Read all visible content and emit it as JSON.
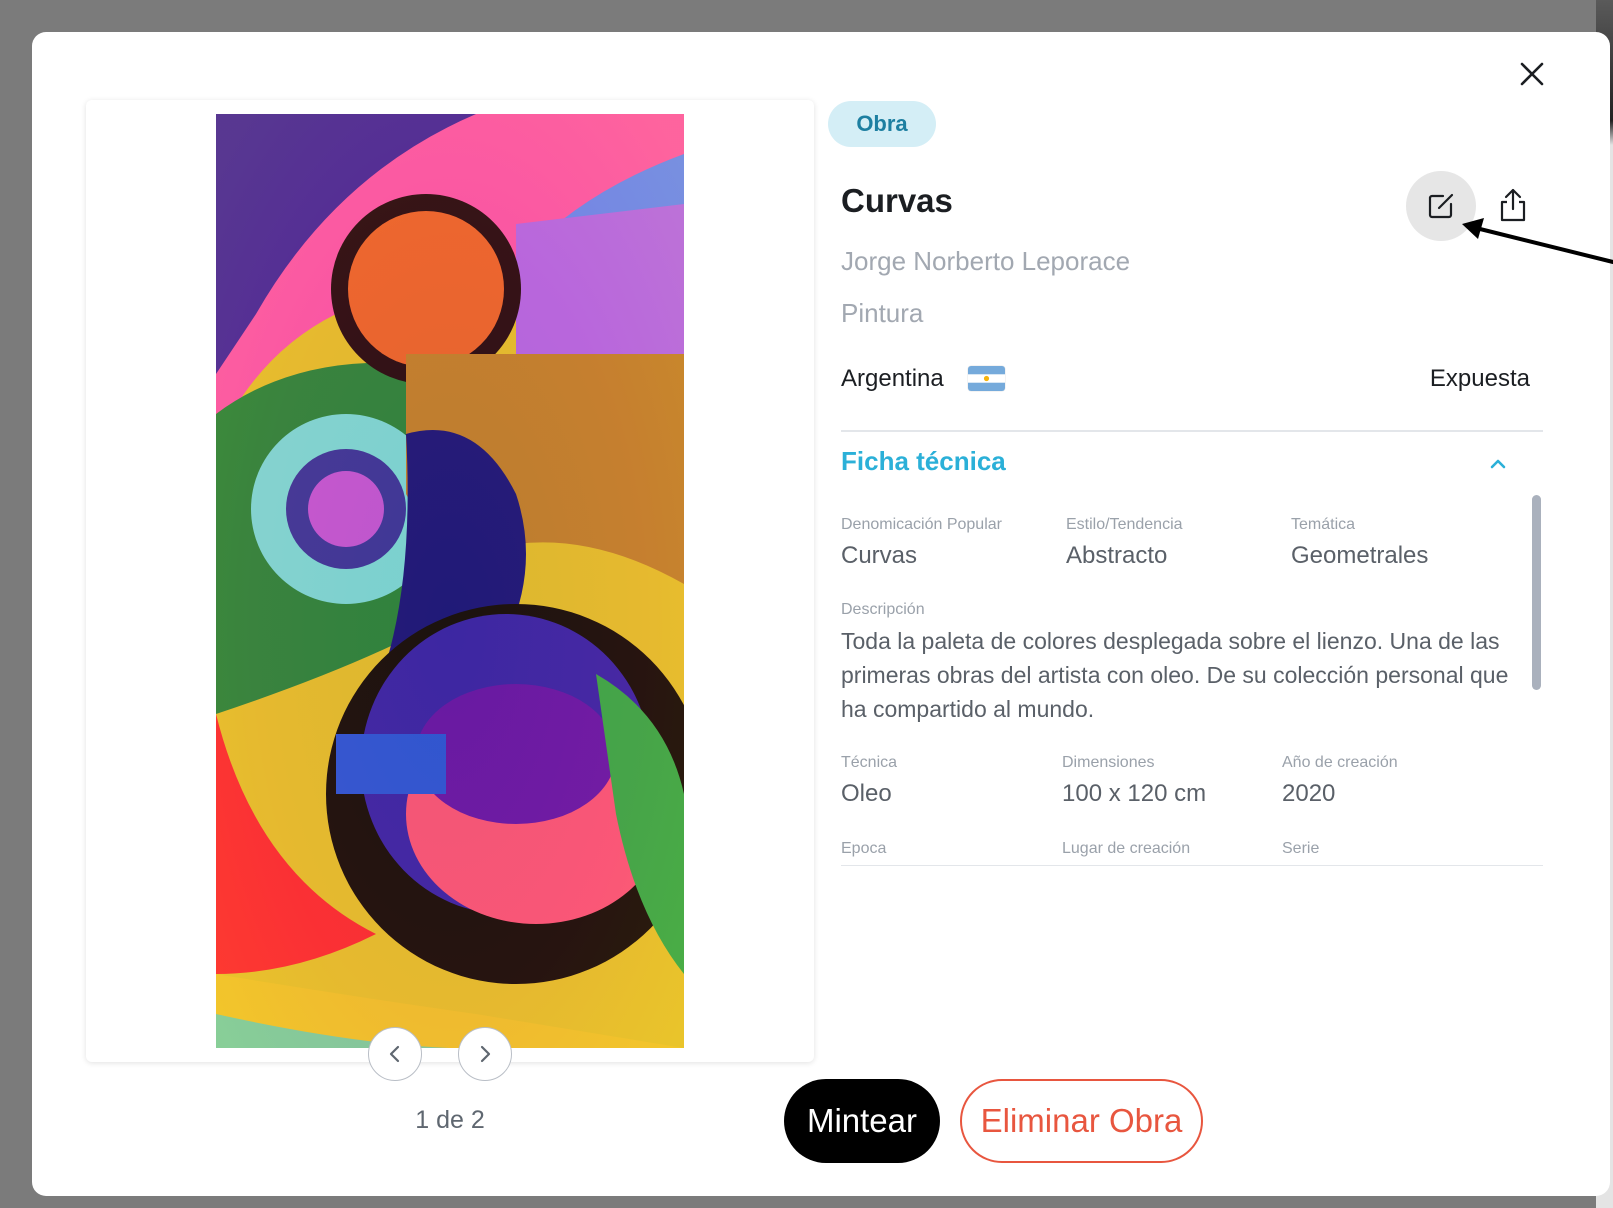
{
  "modal": {
    "tag": "Obra",
    "title": "Curvas",
    "author": "Jorge Norberto Leporace",
    "category": "Pintura",
    "country": "Argentina",
    "status": "Expuesta",
    "close_icon": "close-icon",
    "edit_icon": "edit-icon",
    "share_icon": "share-icon"
  },
  "gallery": {
    "counter": "1 de 2",
    "prev_icon": "chevron-left-icon",
    "next_icon": "chevron-right-icon"
  },
  "ficha": {
    "title": "Ficha técnica",
    "row1": [
      {
        "label": "Denomicación Popular",
        "value": "Curvas"
      },
      {
        "label": "Estilo/Tendencia",
        "value": "Abstracto"
      },
      {
        "label": "Temática",
        "value": "Geometrales"
      }
    ],
    "description_label": "Descripción",
    "description": "Toda la paleta de colores desplegada sobre el lienzo. Una de las primeras obras del artista con oleo. De su colección personal que ha compartido al mundo.",
    "row2": [
      {
        "label": "Técnica",
        "value": "Oleo"
      },
      {
        "label": "Dimensiones",
        "value": "100 x 120 cm"
      },
      {
        "label": "Año de creación",
        "value": "2020"
      }
    ],
    "row3": [
      {
        "label": "Epoca"
      },
      {
        "label": "Lugar de creación"
      },
      {
        "label": "Serie"
      }
    ]
  },
  "actions": {
    "mint": "Mintear",
    "delete": "Eliminar Obra"
  },
  "colors": {
    "accent": "#2bb0d8",
    "danger": "#e8563f",
    "tag_bg": "#d4eef6",
    "tag_text": "#1d7fa1"
  }
}
